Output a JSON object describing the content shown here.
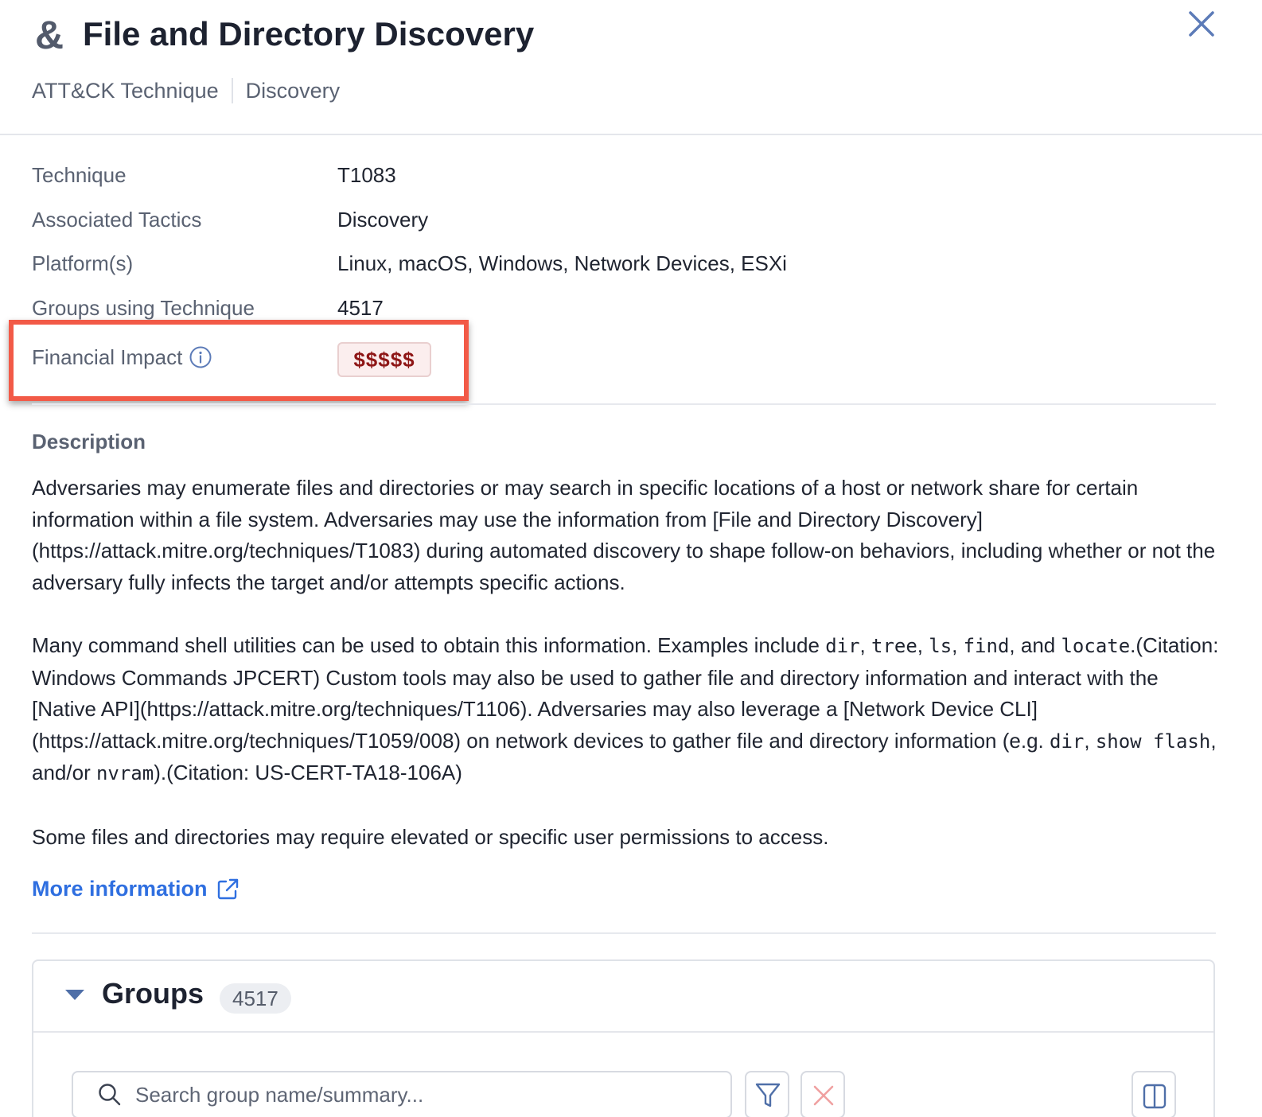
{
  "header": {
    "icon": "ampersand-icon",
    "icon_glyph": "&",
    "title": "File and Directory Discovery",
    "breadcrumbs": [
      "ATT&CK Technique",
      "Discovery"
    ]
  },
  "properties": [
    {
      "label": "Technique",
      "value": "T1083"
    },
    {
      "label": "Associated Tactics",
      "value": "Discovery"
    },
    {
      "label": "Platform(s)",
      "value": "Linux, macOS, Windows, Network Devices, ESXi"
    },
    {
      "label": "Groups using Technique",
      "value": "4517"
    }
  ],
  "financial_impact": {
    "label": "Financial Impact",
    "value": "$$$$$",
    "badge_color": "#8e1616"
  },
  "description": {
    "heading": "Description",
    "p1": "Adversaries may enumerate files and directories or may search in specific locations of a host or network share for certain information within a file system. Adversaries may use the information from [File and Directory Discovery](https://attack.mitre.org/techniques/T1083) during automated discovery to shape follow-on behaviors, including whether or not the adversary fully infects the target and/or attempts specific actions.",
    "p2_parts": {
      "a": "Many command shell utilities can be used to obtain this information. Examples include ",
      "c1": "dir",
      "s1": ", ",
      "c2": "tree",
      "s2": ", ",
      "c3": "ls",
      "s3": ", ",
      "c4": "find",
      "s4": ", and ",
      "c5": "locate",
      "b": ".(Citation: Windows Commands JPCERT) Custom tools may also be used to gather file and directory information and interact with the [Native API](https://attack.mitre.org/techniques/T1106). Adversaries may also leverage a [Network Device CLI](https://attack.mitre.org/techniques/T1059/008) on network devices to gather file and directory information (e.g. ",
      "c6": "dir",
      "s6": ", ",
      "c7": "show flash",
      "s7": ", and/or ",
      "c8": "nvram",
      "d": ").(Citation: US-CERT-TA18-106A)"
    },
    "p3": "Some files and directories may require elevated or specific user permissions to access."
  },
  "more_information": {
    "label": "More information",
    "icon": "external-link-icon",
    "color": "#2f6fe0"
  },
  "groups": {
    "title": "Groups",
    "count": "4517",
    "search_placeholder": "Search group name/summary...",
    "search_value": "",
    "buttons": [
      "filter-icon",
      "clear-filter-icon",
      "columns-icon"
    ]
  },
  "highlight_color": "#f25a47"
}
